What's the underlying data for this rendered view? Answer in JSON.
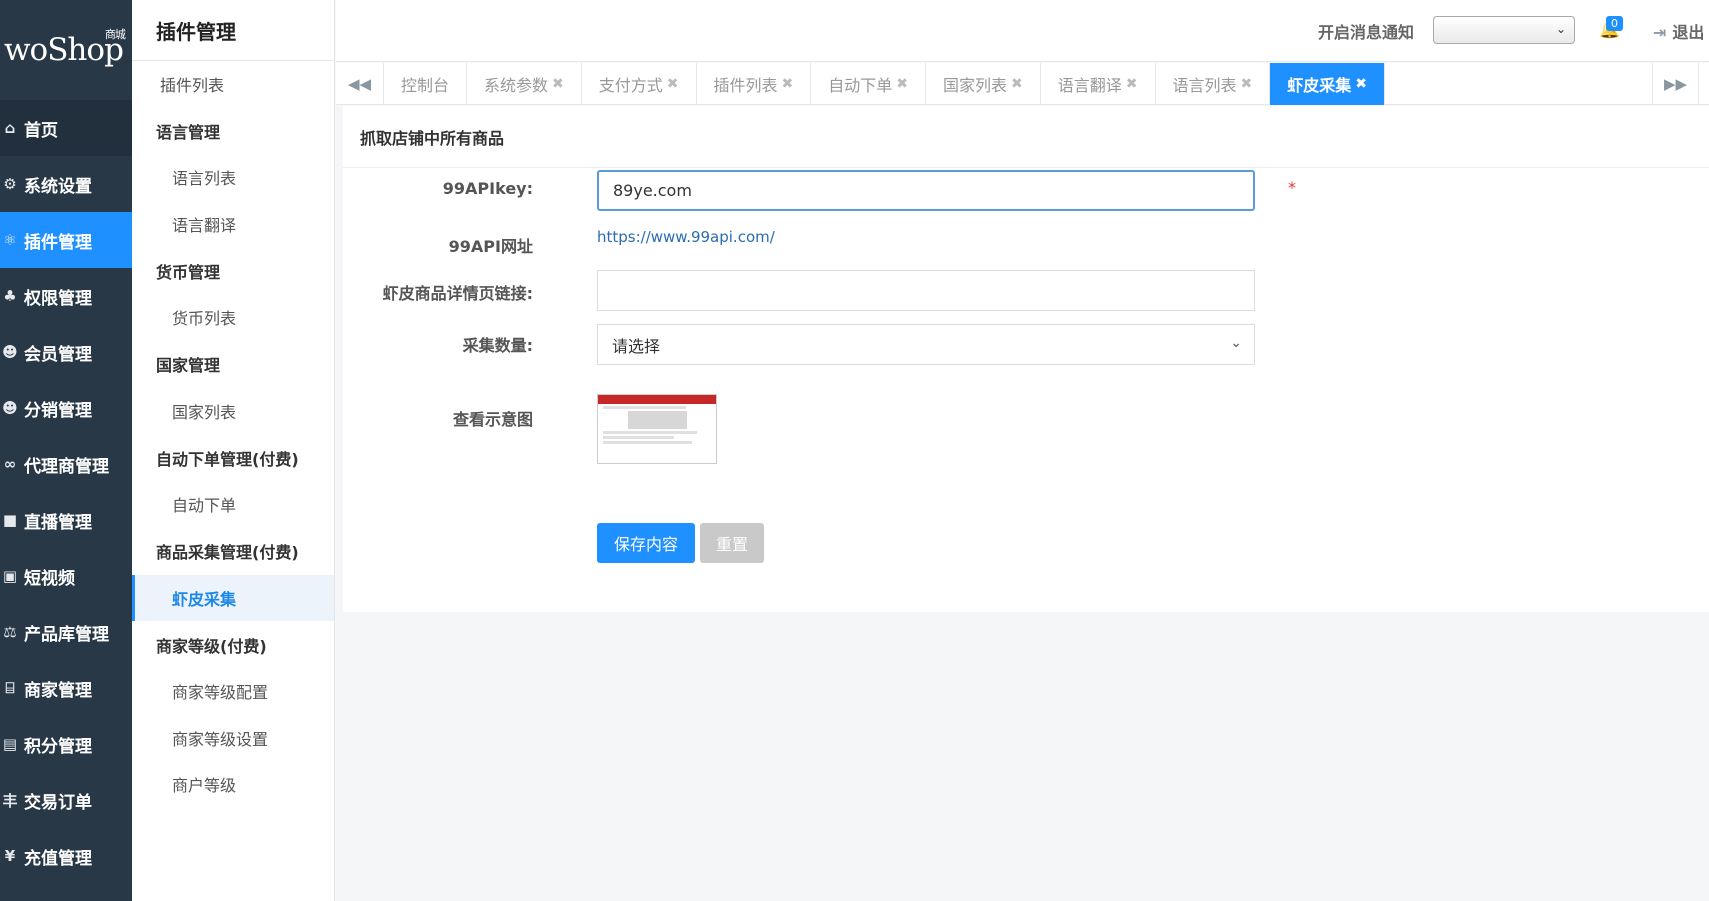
{
  "brand": {
    "logo": "woShop",
    "logo_sub": "商城"
  },
  "sidebar": {
    "items": [
      {
        "label": "首页",
        "icon": "home-icon",
        "glyph": "⌂"
      },
      {
        "label": "系统设置",
        "icon": "gear-icon",
        "glyph": "⚙"
      },
      {
        "label": "插件管理",
        "icon": "plugin-icon",
        "glyph": "⚛"
      },
      {
        "label": "权限管理",
        "icon": "sitemap-icon",
        "glyph": "♣"
      },
      {
        "label": "会员管理",
        "icon": "users-icon",
        "glyph": "☻"
      },
      {
        "label": "分销管理",
        "icon": "users-icon",
        "glyph": "☻"
      },
      {
        "label": "代理商管理",
        "icon": "bicycle-icon",
        "glyph": "∞"
      },
      {
        "label": "直播管理",
        "icon": "video-icon",
        "glyph": "■"
      },
      {
        "label": "短视频",
        "icon": "file-video-icon",
        "glyph": "▣"
      },
      {
        "label": "产品库管理",
        "icon": "balance-scale-icon",
        "glyph": "⚖"
      },
      {
        "label": "商家管理",
        "icon": "bank-icon",
        "glyph": "⌸"
      },
      {
        "label": "积分管理",
        "icon": "file-icon",
        "glyph": "▤"
      },
      {
        "label": "交易订单",
        "icon": "order-icon",
        "glyph": "丰"
      },
      {
        "label": "充值管理",
        "icon": "yen-icon",
        "glyph": "¥"
      }
    ]
  },
  "subnav": {
    "title": "插件管理",
    "plugin_list": "插件列表",
    "groups": [
      {
        "title": "语言管理",
        "children": [
          "语言列表",
          "语言翻译"
        ]
      },
      {
        "title": "货币管理",
        "children": [
          "货币列表"
        ]
      },
      {
        "title": "国家管理",
        "children": [
          "国家列表"
        ]
      },
      {
        "title": "自动下单管理(付费)",
        "children": [
          "自动下单"
        ]
      },
      {
        "title": "商品采集管理(付费)",
        "children": [
          "虾皮采集"
        ]
      },
      {
        "title": "商家等级(付费)",
        "children": [
          "商家等级配置",
          "商家等级设置",
          "商户等级"
        ]
      }
    ]
  },
  "header": {
    "notify_label": "开启消息通知",
    "notify_selected": "",
    "bell_count": "0",
    "logout": "退出"
  },
  "tabs": {
    "items": [
      {
        "label": "控制台",
        "closable": false
      },
      {
        "label": "系统参数",
        "closable": true
      },
      {
        "label": "支付方式",
        "closable": true
      },
      {
        "label": "插件列表",
        "closable": true
      },
      {
        "label": "自动下单",
        "closable": true
      },
      {
        "label": "国家列表",
        "closable": true
      },
      {
        "label": "语言翻译",
        "closable": true
      },
      {
        "label": "语言列表",
        "closable": true
      },
      {
        "label": "虾皮采集",
        "closable": true,
        "active": true
      }
    ]
  },
  "form": {
    "title": "抓取店铺中所有商品",
    "apikey_label": "99APIkey:",
    "apikey_value": "89ye.com",
    "required_mark": "*",
    "apiurl_label": "99API网址",
    "apiurl_link": "https://www.99api.com/",
    "detail_link_label": "虾皮商品详情页链接:",
    "detail_link_value": "",
    "count_label": "采集数量:",
    "count_placeholder": "请选择",
    "preview_label": "查看示意图",
    "save_label": "保存内容",
    "reset_label": "重置"
  },
  "colors": {
    "primary": "#1e90ff",
    "sidebar_bg": "#283846",
    "required": "#e53935"
  }
}
